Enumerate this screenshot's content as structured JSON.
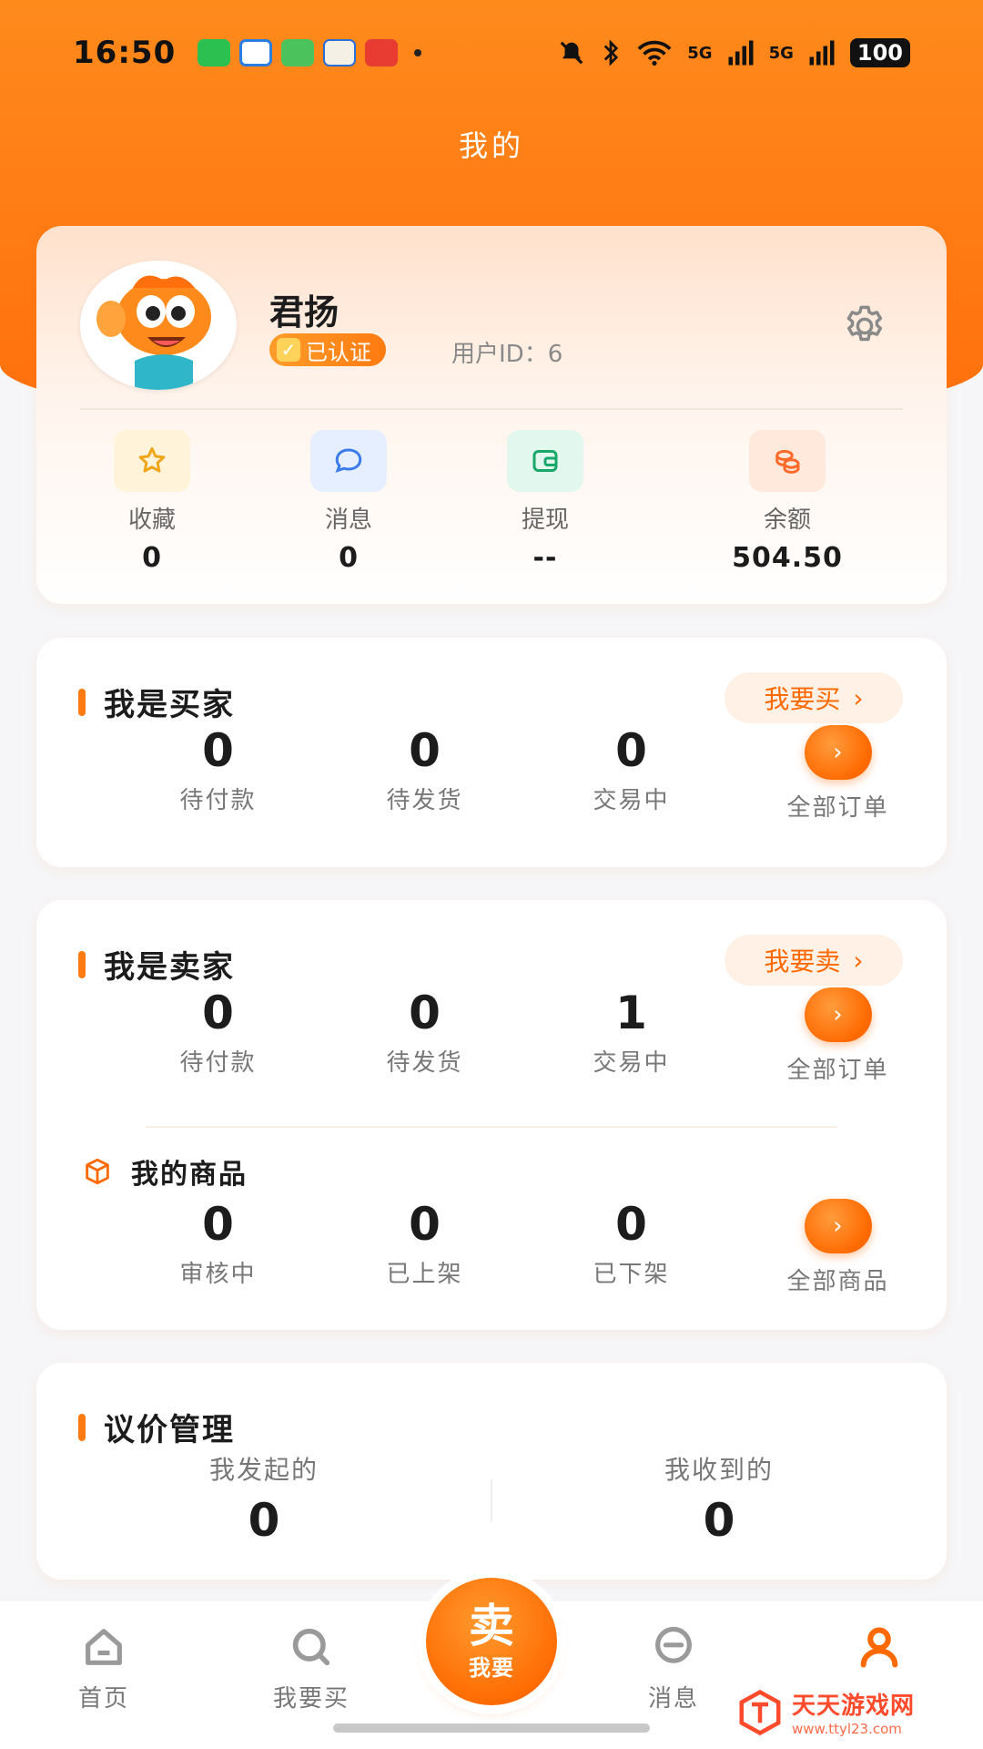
{
  "status_bar": {
    "time": "16:50",
    "network": "5G",
    "battery": "100"
  },
  "page": {
    "title": "我的"
  },
  "profile": {
    "name": "君扬",
    "verified_label": "已认证",
    "user_id_text": "用户ID：6",
    "stats": [
      {
        "icon": "star-icon",
        "label": "收藏",
        "value": "0"
      },
      {
        "icon": "chat-bubble-icon",
        "label": "消息",
        "value": "0"
      },
      {
        "icon": "wallet-icon",
        "label": "提现",
        "value": "--"
      },
      {
        "icon": "coins-icon",
        "label": "余额",
        "value": "504.50"
      }
    ]
  },
  "buyer": {
    "title": "我是买家",
    "action_label": "我要买",
    "orders": [
      {
        "label": "待付款",
        "value": "0"
      },
      {
        "label": "待发货",
        "value": "0"
      },
      {
        "label": "交易中",
        "value": "0"
      }
    ],
    "all_orders_label": "全部订单"
  },
  "seller": {
    "title": "我是卖家",
    "action_label": "我要卖",
    "orders": [
      {
        "label": "待付款",
        "value": "0"
      },
      {
        "label": "待发货",
        "value": "0"
      },
      {
        "label": "交易中",
        "value": "1"
      }
    ],
    "all_orders_label": "全部订单",
    "goods": {
      "title": "我的商品",
      "items": [
        {
          "label": "审核中",
          "value": "0"
        },
        {
          "label": "已上架",
          "value": "0"
        },
        {
          "label": "已下架",
          "value": "0"
        }
      ],
      "all_goods_label": "全部商品"
    }
  },
  "bargain": {
    "title": "议价管理",
    "items": [
      {
        "label": "我发起的",
        "value": "0"
      },
      {
        "label": "我收到的",
        "value": "0"
      }
    ]
  },
  "bottom_nav": {
    "home": "首页",
    "buy": "我要买",
    "sell_big": "卖",
    "sell_small": "我要",
    "messages": "消息"
  },
  "watermark": {
    "title": "天天游戏网",
    "url": "www.ttyl23.com"
  },
  "colors": {
    "accent": "#ff6a00",
    "hero_gradient_start": "#ff8a1c",
    "hero_gradient_end": "#ff6f0c"
  }
}
